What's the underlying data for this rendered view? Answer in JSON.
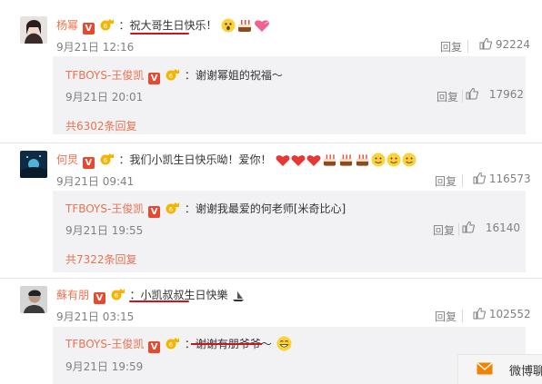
{
  "comments": [
    {
      "user": "杨幂",
      "text": "：祝大哥生日快乐！",
      "time": "9月21日 12:16",
      "reply_label": "回复",
      "likes": "92224",
      "reply": {
        "user": "TFBOYS-王俊凯",
        "text": "：谢谢幂姐的祝福～",
        "time": "9月21日 20:01",
        "reply_label": "回复",
        "likes": "17962"
      },
      "more": "共6302条回复"
    },
    {
      "user": "何炅",
      "text": "：我们小凯生日快乐呦！爱你！",
      "time": "9月21日 09:41",
      "reply_label": "回复",
      "likes": "116573",
      "reply": {
        "user": "TFBOYS-王俊凯",
        "text": "：谢谢我最爱的何老师[米奇比心]",
        "time": "9月21日 19:55",
        "reply_label": "回复",
        "likes": "16140"
      },
      "more": "共7322条回复"
    },
    {
      "user": "蘇有朋",
      "text": "：小凯叔叔生日快樂",
      "time": "9月21日 03:15",
      "reply_label": "回复",
      "likes": "102552",
      "reply": {
        "user": "TFBOYS-王俊凯",
        "text": "：谢谢有朋爷爷～",
        "time": "9月21日 19:59",
        "reply_label": "",
        "likes": ""
      }
    }
  ],
  "bottom_tip": {
    "label": "微博聊"
  },
  "colors": {
    "accent": "#eb7350",
    "badge": "#e8482e",
    "underline": "#c8161d",
    "reply_bg": "#f2f2f5"
  }
}
